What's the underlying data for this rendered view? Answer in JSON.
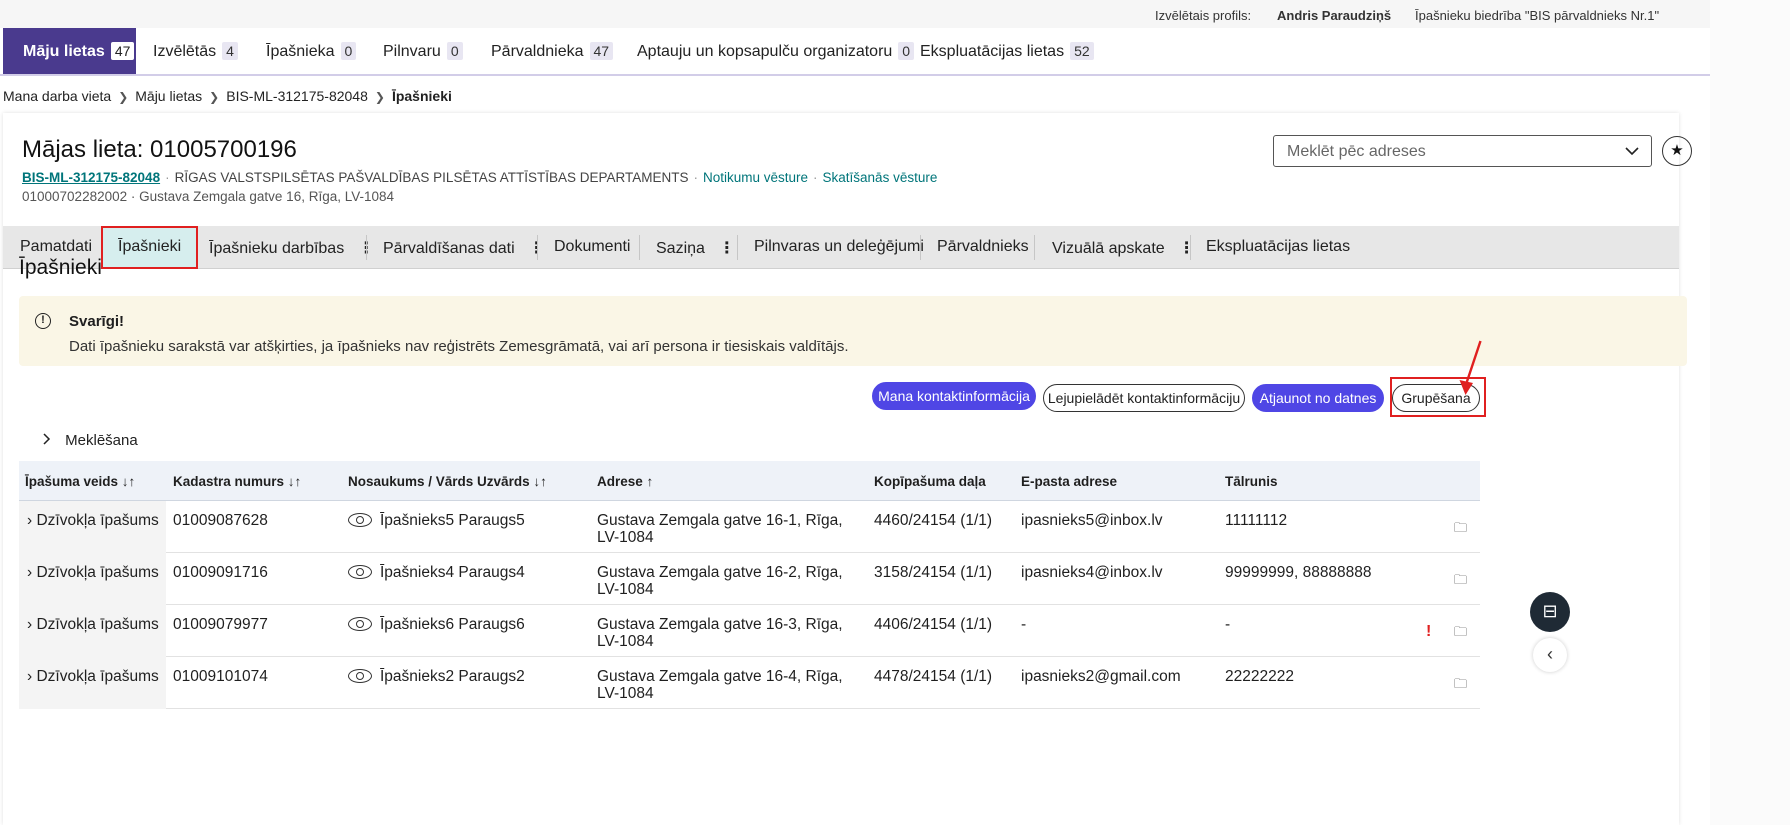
{
  "profile": {
    "label": "Izvēlētais profils:",
    "user": "Andris Paraudziņš",
    "org": "Īpašnieku biedrība \"BIS pārvaldnieks Nr.1\""
  },
  "top_tabs": [
    {
      "label": "Māju lietas",
      "count": "47"
    },
    {
      "label": "Izvēlētās",
      "count": "4"
    },
    {
      "label": "Īpašnieka",
      "count": "0"
    },
    {
      "label": "Pilnvaru",
      "count": "0"
    },
    {
      "label": "Pārvaldnieka",
      "count": "47"
    },
    {
      "label": "Aptauju un kopsapulču organizatoru",
      "count": "0"
    },
    {
      "label": "Ekspluatācijas lietas",
      "count": "52"
    }
  ],
  "breadcrumb": [
    "Mana darba vieta",
    "Māju lietas",
    "BIS-ML-312175-82048",
    "Īpašnieki"
  ],
  "page": {
    "title": "Mājas lieta: 01005700196",
    "case_code": "BIS-ML-312175-82048",
    "department": "RĪGAS VALSTSPILSĒTAS PAŠVALDĪBAS PILSĒTAS ATTĪSTĪBAS DEPARTAMENTS",
    "link_history": "Notikumu vēsture",
    "link_views": "Skatīšanās vēsture",
    "address_line": "01000702282002 · Gustava Zemgala gatve 16, Rīga, LV-1084",
    "search_placeholder": "Meklēt pēc adreses"
  },
  "section_tabs": [
    {
      "label": "Pamatdati"
    },
    {
      "label": "Īpašnieki"
    },
    {
      "label": "Īpašnieku darbības"
    },
    {
      "label": "Pārvaldīšanas dati"
    },
    {
      "label": "Dokumenti"
    },
    {
      "label": "Saziņa"
    },
    {
      "label": "Pilnvaras un deleģējumi"
    },
    {
      "label": "Pārvaldnieks"
    },
    {
      "label": "Vizuālā apskate"
    },
    {
      "label": "Ekspluatācijas lietas"
    }
  ],
  "kebab": "⋮",
  "section_title": "Īpašnieki",
  "alert": {
    "title": "Svarīgi!",
    "text": "Dati īpašnieku sarakstā var atšķirties, ja īpašnieks nav reģistrēts Zemesgrāmatā, vai arī persona ir tiesiskais valdītājs."
  },
  "buttons": {
    "my_contact": "Mana kontaktinformācija",
    "download_contact": "Lejupielādēt kontaktinformāciju",
    "update_from_file": "Atjaunot no datnes",
    "grouping": "Grupēšana"
  },
  "search_toggle": "Meklēšana",
  "table": {
    "headers": [
      "Īpašuma veids ↓↑",
      "Kadastra numurs ↓↑",
      "Nosaukums / Vārds Uzvārds ↓↑",
      "Adrese ↑",
      "Kopīpašuma daļa",
      "E-pasta adrese",
      "Tālrunis"
    ],
    "rows": [
      {
        "type": "Dzīvokļa īpašums",
        "cadastre": "01009087628",
        "name": "Īpašnieks5 Paraugs5",
        "address": "Gustava Zemgala gatve 16-1, Rīga, LV-1084",
        "share": "4460/24154 (1/1)",
        "email": "ipasnieks5@inbox.lv",
        "phone": "11111112"
      },
      {
        "type": "Dzīvokļa īpašums",
        "cadastre": "01009091716",
        "name": "Īpašnieks4 Paraugs4",
        "address": "Gustava Zemgala gatve 16-2, Rīga, LV-1084",
        "share": "3158/24154 (1/1)",
        "email": "ipasnieks4@inbox.lv",
        "phone": "99999999, 88888888"
      },
      {
        "type": "Dzīvokļa īpašums",
        "cadastre": "01009079977",
        "name": "Īpašnieks6 Paraugs6",
        "address": "Gustava Zemgala gatve 16-3, Rīga, LV-1084",
        "share": "4406/24154 (1/1)",
        "email": "-",
        "phone": "-",
        "warning": "!"
      },
      {
        "type": "Dzīvokļa īpašums",
        "cadastre": "01009101074",
        "name": "Īpašnieks2 Paraugs2",
        "address": "Gustava Zemgala gatve 16-4, Rīga, LV-1084",
        "share": "4478/24154 (1/1)",
        "email": "ipasnieks2@gmail.com",
        "phone": "22222222"
      }
    ]
  }
}
